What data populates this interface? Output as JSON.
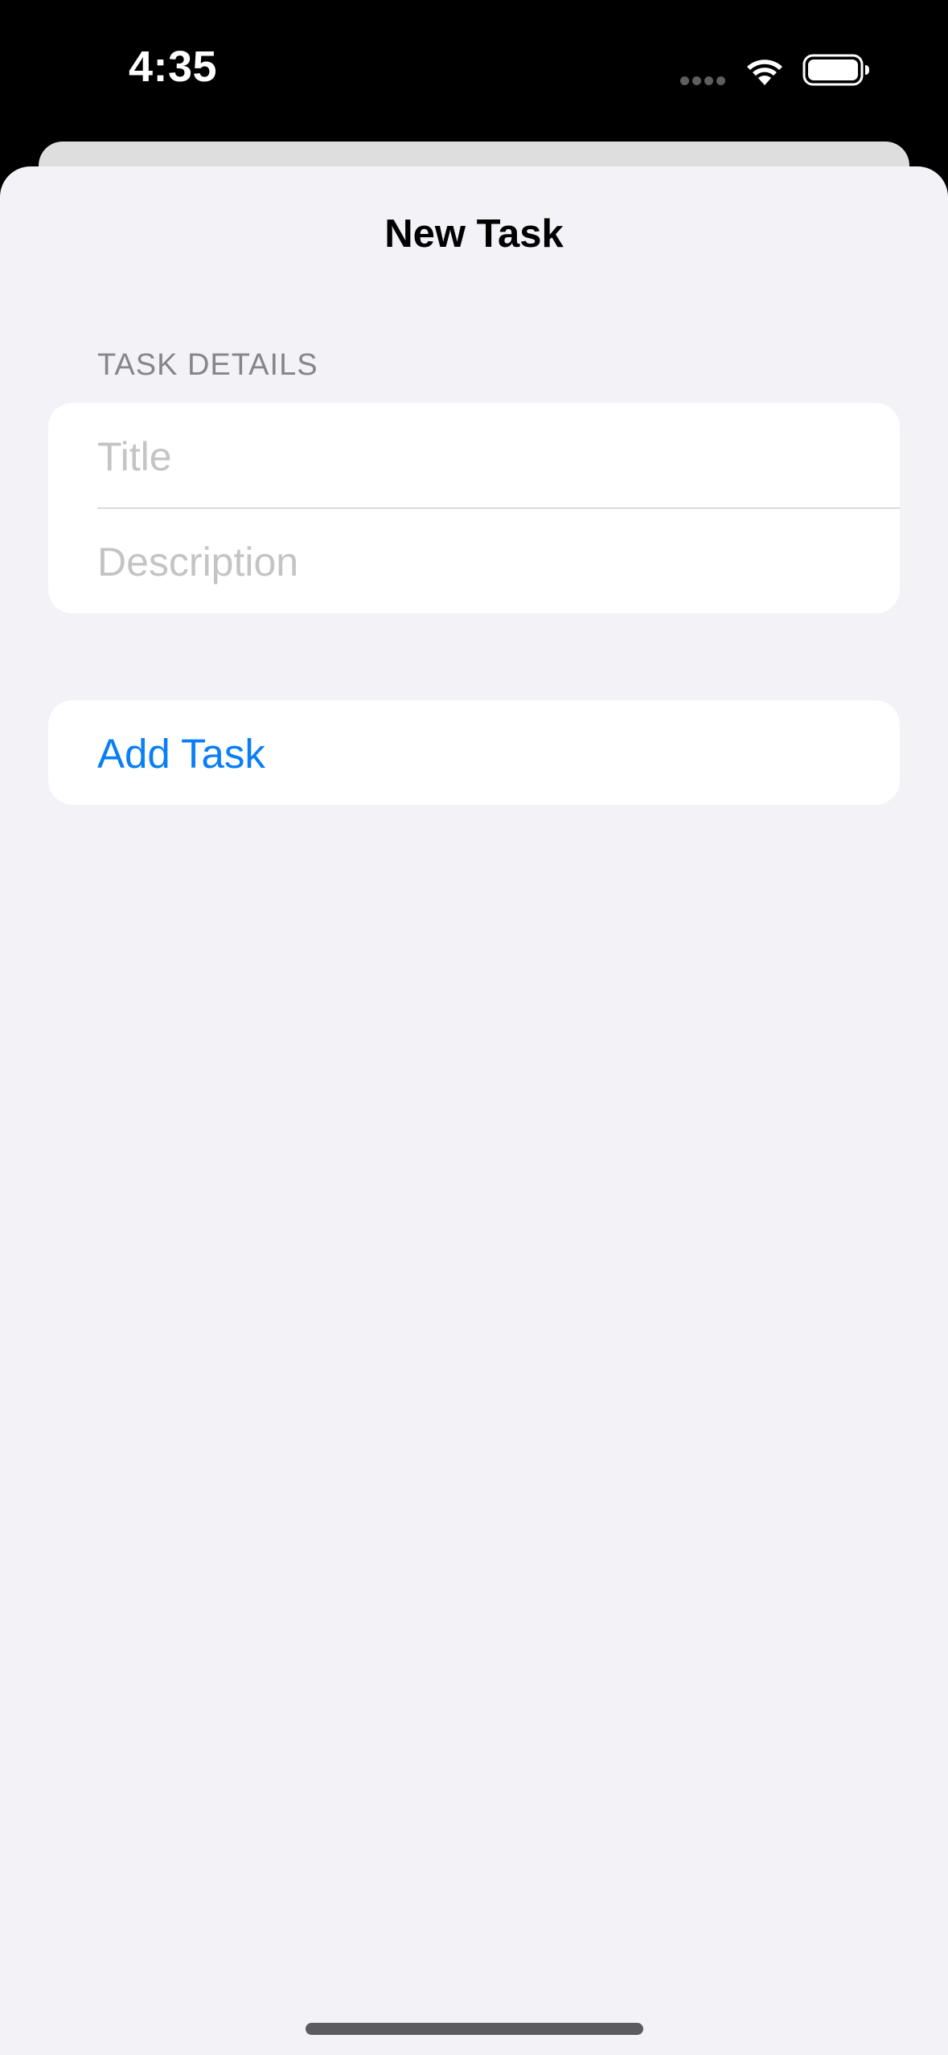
{
  "status_bar": {
    "time": "4:35",
    "icons": [
      "cellular-dots-icon",
      "wifi-icon",
      "battery-icon"
    ]
  },
  "sheet": {
    "title": "New Task",
    "section_header": "TASK DETAILS",
    "fields": {
      "title": {
        "value": "",
        "placeholder": "Title"
      },
      "description": {
        "value": "",
        "placeholder": "Description"
      }
    },
    "add_button_label": "Add Task"
  },
  "colors": {
    "accent": "#0a7ff5",
    "background": "#f2f2f7",
    "section_header": "#85858a",
    "placeholder": "#c4c4c6"
  }
}
